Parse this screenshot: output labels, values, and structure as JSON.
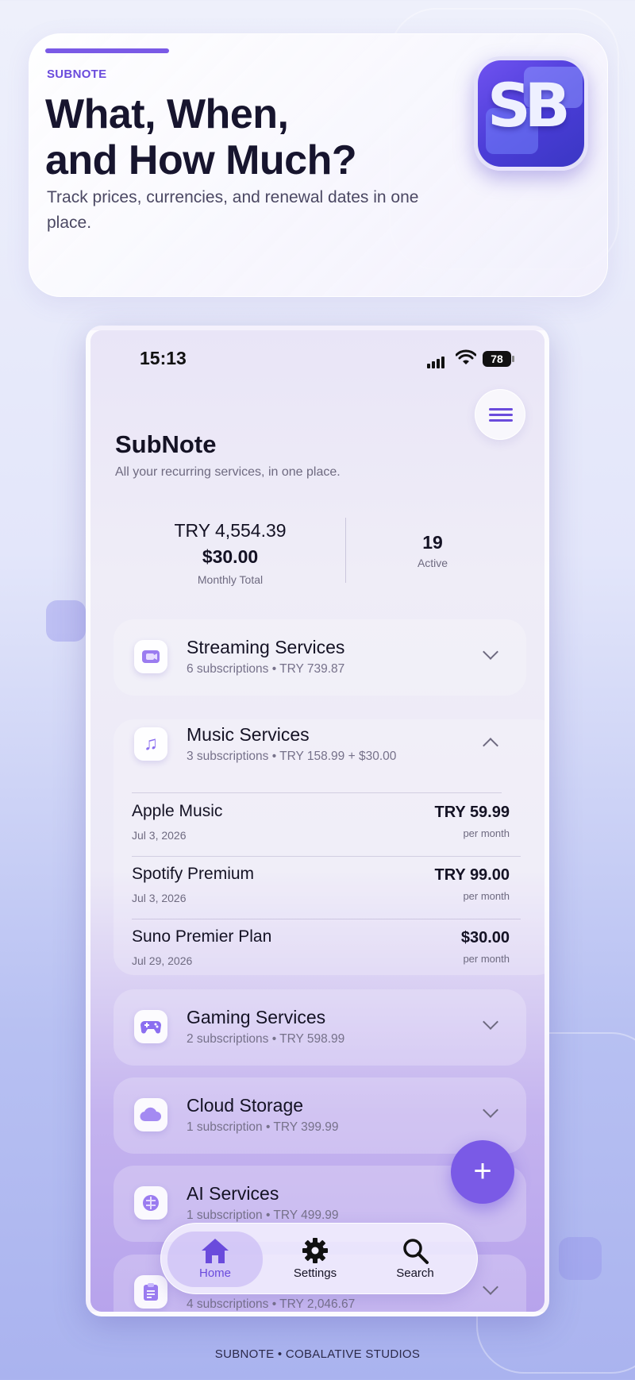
{
  "hero": {
    "kicker": "SUBNOTE",
    "title_line1": "What, When,",
    "title_line2": "and How Much?",
    "subtitle": "Track prices, currencies, and renewal dates in one place.",
    "app_icon_text": "SB"
  },
  "status_bar": {
    "time": "15:13",
    "battery": "78"
  },
  "app": {
    "title": "SubNote",
    "subtitle": "All your recurring services, in one place."
  },
  "summary": {
    "monthly_try": "TRY 4,554.39",
    "monthly_usd": "$30.00",
    "monthly_label": "Monthly Total",
    "active_count": "19",
    "active_label": "Active"
  },
  "categories": [
    {
      "name": "Streaming Services",
      "meta": "6 subscriptions  •  TRY 739.87",
      "icon": "video-icon",
      "expanded": false
    },
    {
      "name": "Music Services",
      "meta": "3 subscriptions  •  TRY 158.99 + $30.00",
      "icon": "music-icon",
      "expanded": true
    },
    {
      "name": "Gaming Services",
      "meta": "2 subscriptions  •  TRY 598.99",
      "icon": "gamepad-icon",
      "expanded": false
    },
    {
      "name": "Cloud Storage",
      "meta": "1 subscription  •  TRY 399.99",
      "icon": "cloud-icon",
      "expanded": false
    },
    {
      "name": "AI Services",
      "meta": "1 subscription  •  TRY 499.99",
      "icon": "brain-icon",
      "expanded": false
    },
    {
      "name": "",
      "meta": "4 subscriptions  •  TRY 2,046.67",
      "icon": "clipboard-icon",
      "expanded": false
    }
  ],
  "music_subscriptions": [
    {
      "name": "Apple Music",
      "date": "Jul 3, 2026",
      "price": "TRY 59.99",
      "period": "per month"
    },
    {
      "name": "Spotify Premium",
      "date": "Jul 3, 2026",
      "price": "TRY 99.00",
      "period": "per month"
    },
    {
      "name": "Suno Premier Plan",
      "date": "Jul 29, 2026",
      "price": "$30.00",
      "period": "per month"
    }
  ],
  "tabs": [
    {
      "label": "Home",
      "icon": "home-icon",
      "active": true
    },
    {
      "label": "Settings",
      "icon": "gear-icon",
      "active": false
    },
    {
      "label": "Search",
      "icon": "search-icon",
      "active": false
    }
  ],
  "fab_label": "+",
  "footer": "SUBNOTE  •  COBALATIVE STUDIOS",
  "colors": {
    "accent": "#7a5ae6",
    "title": "#17152e"
  }
}
